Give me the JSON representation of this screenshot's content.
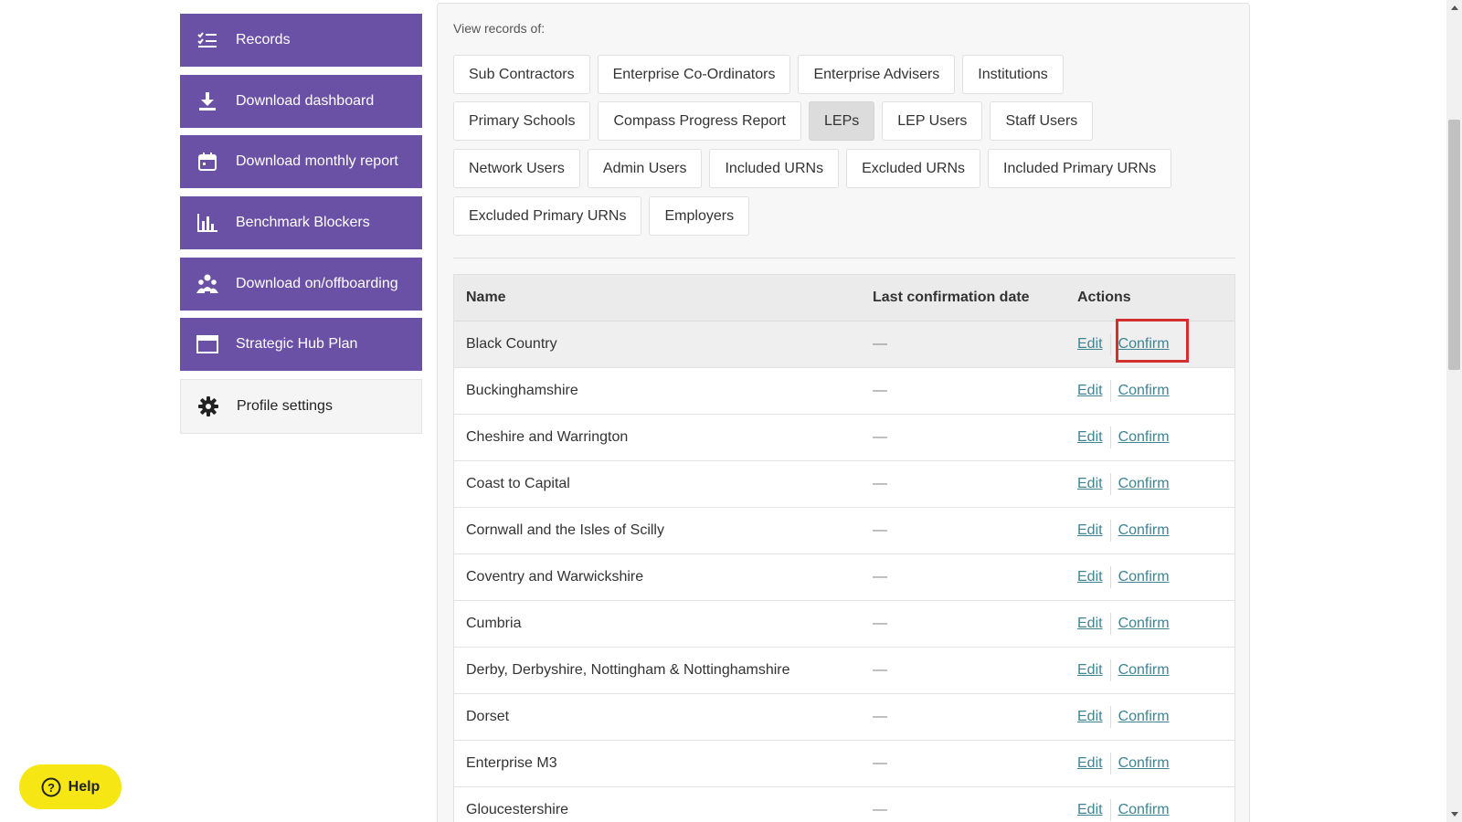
{
  "sidebar": {
    "items": [
      {
        "label": "Records",
        "icon": "list-check-icon"
      },
      {
        "label": "Download dashboard",
        "icon": "download-icon"
      },
      {
        "label": "Download monthly report",
        "icon": "calendar-icon"
      },
      {
        "label": "Benchmark Blockers",
        "icon": "bar-chart-icon"
      },
      {
        "label": "Download on/offboarding",
        "icon": "users-icon"
      },
      {
        "label": "Strategic Hub Plan",
        "icon": "window-icon"
      },
      {
        "label": "Profile settings",
        "icon": "gear-icon"
      }
    ]
  },
  "main": {
    "view_label": "View records of:",
    "filters": [
      [
        "Sub Contractors",
        "Enterprise Co-Ordinators",
        "Enterprise Advisers",
        "Institutions"
      ],
      [
        "Primary Schools",
        "Compass Progress Report",
        "LEPs",
        "LEP Users",
        "Staff Users"
      ],
      [
        "Network Users",
        "Admin Users",
        "Included URNs",
        "Excluded URNs",
        "Included Primary URNs"
      ],
      [
        "Excluded Primary URNs",
        "Employers"
      ]
    ],
    "active_filter": "LEPs",
    "table": {
      "headers": {
        "name": "Name",
        "date": "Last confirmation date",
        "actions": "Actions"
      },
      "edit_label": "Edit",
      "confirm_label": "Confirm",
      "rows": [
        {
          "name": "Black Country",
          "date": "—"
        },
        {
          "name": "Buckinghamshire",
          "date": "—"
        },
        {
          "name": "Cheshire and Warrington",
          "date": "—"
        },
        {
          "name": "Coast to Capital",
          "date": "—"
        },
        {
          "name": "Cornwall and the Isles of Scilly",
          "date": "—"
        },
        {
          "name": "Coventry and Warwickshire",
          "date": "—"
        },
        {
          "name": "Cumbria",
          "date": "—"
        },
        {
          "name": "Derby, Derbyshire, Nottingham & Nottinghamshire",
          "date": "—"
        },
        {
          "name": "Dorset",
          "date": "—"
        },
        {
          "name": "Enterprise M3",
          "date": "—"
        },
        {
          "name": "Gloucestershire",
          "date": "—"
        }
      ]
    }
  },
  "help": {
    "label": "Help",
    "icon": "question-circle-icon"
  },
  "colors": {
    "sidebar_purple": "#6a51a6",
    "link_teal": "#3d8591",
    "help_yellow": "#f5e614",
    "highlight_red": "#d32f2f"
  }
}
